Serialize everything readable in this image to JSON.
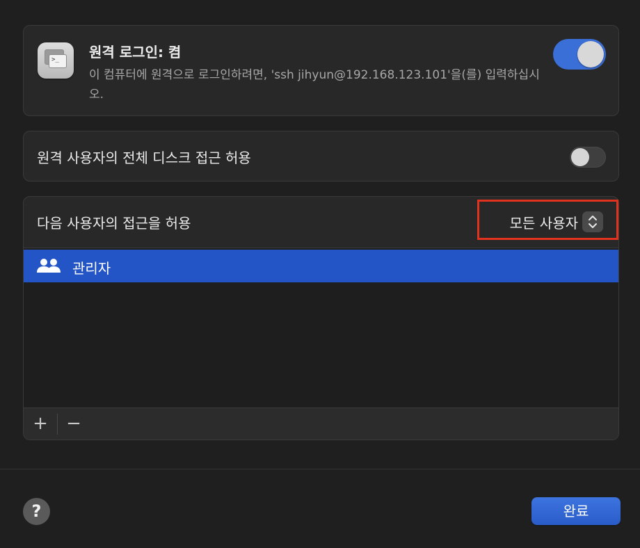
{
  "remote_login": {
    "title": "원격 로그인: 켬",
    "description": "이 컴퓨터에 원격으로 로그인하려면, 'ssh jihyun@192.168.123.101'을(를) 입력하십시오.",
    "icon": "terminal-window-icon",
    "icon_glyph": ">_",
    "toggle_on": true
  },
  "full_disk_access": {
    "label": "원격 사용자의 전체 디스크 접근 허용",
    "toggle_on": false
  },
  "allow_access": {
    "label": "다음 사용자의 접근을 허용",
    "popup_value": "모든 사용자",
    "stepper_up": "⌃",
    "stepper_down": "⌄",
    "users": [
      {
        "name": "관리자",
        "icon": "group-users-icon"
      }
    ],
    "add_label": "+",
    "remove_label": "−"
  },
  "footer": {
    "help_label": "?",
    "done_label": "완료"
  },
  "colors": {
    "accent": "#3b6fd8",
    "selection": "#2355c6",
    "highlight": "#e0321f",
    "background": "#1f1f1f"
  }
}
